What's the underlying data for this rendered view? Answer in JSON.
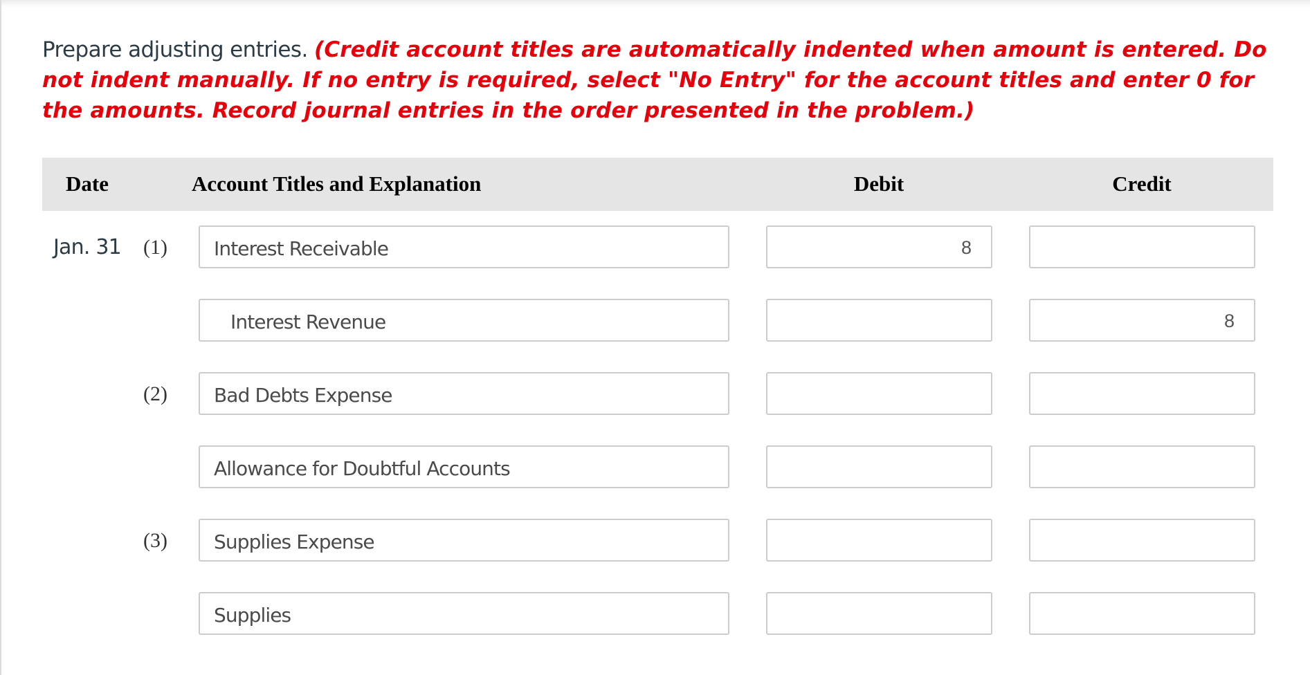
{
  "instructions": {
    "lead": "Prepare adjusting entries.",
    "note": "(Credit account titles are automatically indented when amount is entered. Do not indent manually. If no entry is required, select \"No Entry\" for the account titles and enter 0 for the amounts. Record journal entries in the order presented in the problem.)",
    "note_color": "#e8000b"
  },
  "table": {
    "headers": {
      "date": "Date",
      "account": "Account Titles and Explanation",
      "debit": "Debit",
      "credit": "Credit"
    },
    "rows": [
      {
        "date": "Jan. 31",
        "number": "(1)",
        "account": "Interest Receivable",
        "debit": "8",
        "credit": "",
        "indented": false
      },
      {
        "date": "",
        "number": "",
        "account": "Interest Revenue",
        "debit": "",
        "credit": "8",
        "indented": true
      },
      {
        "date": "",
        "number": "(2)",
        "account": "Bad Debts Expense",
        "debit": "",
        "credit": "",
        "indented": false
      },
      {
        "date": "",
        "number": "",
        "account": "Allowance for Doubtful Accounts",
        "debit": "",
        "credit": "",
        "indented": false
      },
      {
        "date": "",
        "number": "(3)",
        "account": "Supplies Expense",
        "debit": "",
        "credit": "",
        "indented": false
      },
      {
        "date": "",
        "number": "",
        "account": "Supplies",
        "debit": "",
        "credit": "",
        "indented": false
      }
    ]
  }
}
